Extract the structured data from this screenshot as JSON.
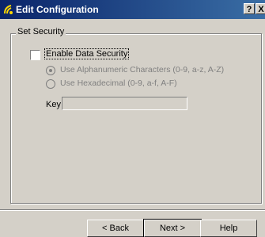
{
  "window": {
    "title": "Edit Configuration",
    "help_glyph": "?",
    "close_glyph": "X"
  },
  "group": {
    "title": "Set Security"
  },
  "enable_security": {
    "label": "Enable Data Security",
    "checked": false
  },
  "radios": [
    {
      "label": "Use Alphanumeric Characters (0-9, a-z, A-Z)",
      "selected": true,
      "enabled": false
    },
    {
      "label": "Use Hexadecimal (0-9, a-f, A-F)",
      "selected": false,
      "enabled": false
    }
  ],
  "key": {
    "label": "Key",
    "value": "",
    "enabled": false
  },
  "buttons": {
    "back": "< Back",
    "next": "Next >",
    "help": "Help"
  },
  "colors": {
    "title_bar_start": "#0a246a",
    "title_bar_end": "#3a6ea5",
    "window_bg": "#d4d0c8",
    "disabled_text": "#808080"
  },
  "icons": {
    "app": "config-icon"
  }
}
